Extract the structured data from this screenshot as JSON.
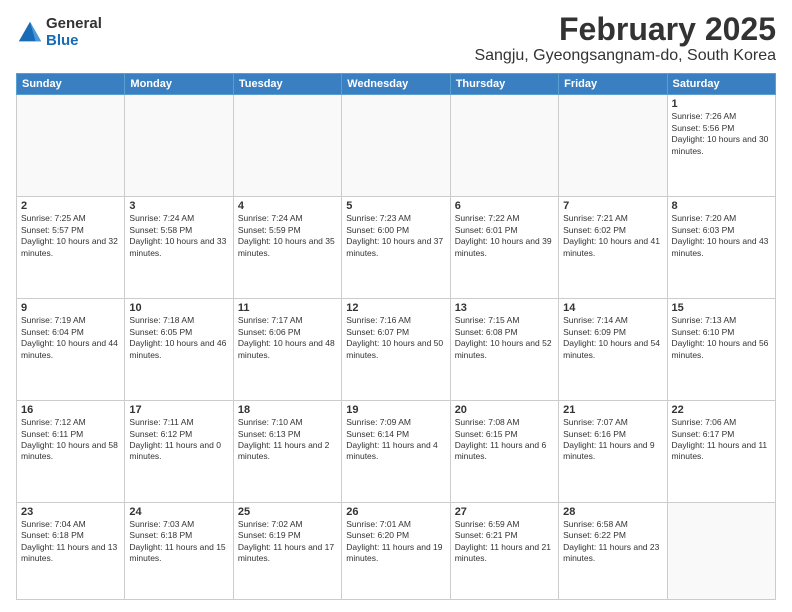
{
  "logo": {
    "general": "General",
    "blue": "Blue"
  },
  "header": {
    "month": "February 2025",
    "location": "Sangju, Gyeongsangnam-do, South Korea"
  },
  "days_of_week": [
    "Sunday",
    "Monday",
    "Tuesday",
    "Wednesday",
    "Thursday",
    "Friday",
    "Saturday"
  ],
  "weeks": [
    [
      {
        "day": "",
        "info": ""
      },
      {
        "day": "",
        "info": ""
      },
      {
        "day": "",
        "info": ""
      },
      {
        "day": "",
        "info": ""
      },
      {
        "day": "",
        "info": ""
      },
      {
        "day": "",
        "info": ""
      },
      {
        "day": "1",
        "info": "Sunrise: 7:26 AM\nSunset: 5:56 PM\nDaylight: 10 hours and 30 minutes."
      }
    ],
    [
      {
        "day": "2",
        "info": "Sunrise: 7:25 AM\nSunset: 5:57 PM\nDaylight: 10 hours and 32 minutes."
      },
      {
        "day": "3",
        "info": "Sunrise: 7:24 AM\nSunset: 5:58 PM\nDaylight: 10 hours and 33 minutes."
      },
      {
        "day": "4",
        "info": "Sunrise: 7:24 AM\nSunset: 5:59 PM\nDaylight: 10 hours and 35 minutes."
      },
      {
        "day": "5",
        "info": "Sunrise: 7:23 AM\nSunset: 6:00 PM\nDaylight: 10 hours and 37 minutes."
      },
      {
        "day": "6",
        "info": "Sunrise: 7:22 AM\nSunset: 6:01 PM\nDaylight: 10 hours and 39 minutes."
      },
      {
        "day": "7",
        "info": "Sunrise: 7:21 AM\nSunset: 6:02 PM\nDaylight: 10 hours and 41 minutes."
      },
      {
        "day": "8",
        "info": "Sunrise: 7:20 AM\nSunset: 6:03 PM\nDaylight: 10 hours and 43 minutes."
      }
    ],
    [
      {
        "day": "9",
        "info": "Sunrise: 7:19 AM\nSunset: 6:04 PM\nDaylight: 10 hours and 44 minutes."
      },
      {
        "day": "10",
        "info": "Sunrise: 7:18 AM\nSunset: 6:05 PM\nDaylight: 10 hours and 46 minutes."
      },
      {
        "day": "11",
        "info": "Sunrise: 7:17 AM\nSunset: 6:06 PM\nDaylight: 10 hours and 48 minutes."
      },
      {
        "day": "12",
        "info": "Sunrise: 7:16 AM\nSunset: 6:07 PM\nDaylight: 10 hours and 50 minutes."
      },
      {
        "day": "13",
        "info": "Sunrise: 7:15 AM\nSunset: 6:08 PM\nDaylight: 10 hours and 52 minutes."
      },
      {
        "day": "14",
        "info": "Sunrise: 7:14 AM\nSunset: 6:09 PM\nDaylight: 10 hours and 54 minutes."
      },
      {
        "day": "15",
        "info": "Sunrise: 7:13 AM\nSunset: 6:10 PM\nDaylight: 10 hours and 56 minutes."
      }
    ],
    [
      {
        "day": "16",
        "info": "Sunrise: 7:12 AM\nSunset: 6:11 PM\nDaylight: 10 hours and 58 minutes."
      },
      {
        "day": "17",
        "info": "Sunrise: 7:11 AM\nSunset: 6:12 PM\nDaylight: 11 hours and 0 minutes."
      },
      {
        "day": "18",
        "info": "Sunrise: 7:10 AM\nSunset: 6:13 PM\nDaylight: 11 hours and 2 minutes."
      },
      {
        "day": "19",
        "info": "Sunrise: 7:09 AM\nSunset: 6:14 PM\nDaylight: 11 hours and 4 minutes."
      },
      {
        "day": "20",
        "info": "Sunrise: 7:08 AM\nSunset: 6:15 PM\nDaylight: 11 hours and 6 minutes."
      },
      {
        "day": "21",
        "info": "Sunrise: 7:07 AM\nSunset: 6:16 PM\nDaylight: 11 hours and 9 minutes."
      },
      {
        "day": "22",
        "info": "Sunrise: 7:06 AM\nSunset: 6:17 PM\nDaylight: 11 hours and 11 minutes."
      }
    ],
    [
      {
        "day": "23",
        "info": "Sunrise: 7:04 AM\nSunset: 6:18 PM\nDaylight: 11 hours and 13 minutes."
      },
      {
        "day": "24",
        "info": "Sunrise: 7:03 AM\nSunset: 6:18 PM\nDaylight: 11 hours and 15 minutes."
      },
      {
        "day": "25",
        "info": "Sunrise: 7:02 AM\nSunset: 6:19 PM\nDaylight: 11 hours and 17 minutes."
      },
      {
        "day": "26",
        "info": "Sunrise: 7:01 AM\nSunset: 6:20 PM\nDaylight: 11 hours and 19 minutes."
      },
      {
        "day": "27",
        "info": "Sunrise: 6:59 AM\nSunset: 6:21 PM\nDaylight: 11 hours and 21 minutes."
      },
      {
        "day": "28",
        "info": "Sunrise: 6:58 AM\nSunset: 6:22 PM\nDaylight: 11 hours and 23 minutes."
      },
      {
        "day": "",
        "info": ""
      }
    ]
  ]
}
